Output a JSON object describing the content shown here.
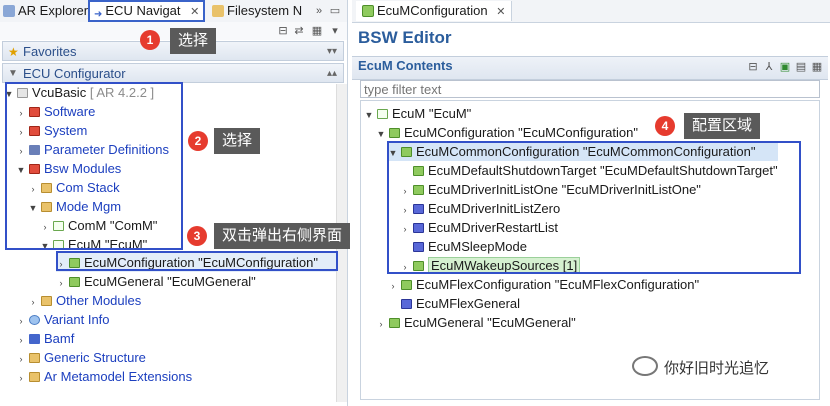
{
  "left_tabs": [
    {
      "label": "AR Explorer"
    },
    {
      "label": "ECU Navigat"
    },
    {
      "label": "Filesystem N"
    }
  ],
  "favorites_label": "Favorites",
  "ecu_configurator_label": "ECU Configurator",
  "tree_left": {
    "vcubasic": "VcuBasic",
    "vcubasic_version": "[ AR 4.2.2 ]",
    "software": "Software",
    "system": "System",
    "parameter_definitions": "Parameter Definitions",
    "bsw_modules": "Bsw Modules",
    "com_stack": "Com Stack",
    "mode_mgm": "Mode Mgm",
    "comm": "ComM \"ComM\"",
    "ecum": "EcuM \"EcuM\"",
    "ecum_configuration": "EcuMConfiguration \"EcuMConfiguration\"",
    "ecum_general": "EcuMGeneral \"EcuMGeneral\"",
    "other_modules": "Other Modules",
    "variant_info": "Variant Info",
    "bamf": "Bamf",
    "generic_structure": "Generic Structure",
    "ar_metamodel_extensions": "Ar Metamodel Extensions"
  },
  "annotations": {
    "a1": {
      "num": "1",
      "text": "选择"
    },
    "a2": {
      "num": "2",
      "text": "选择"
    },
    "a3": {
      "num": "3",
      "text": "双击弹出右侧界面"
    },
    "a4": {
      "num": "4",
      "text": "配置区域"
    }
  },
  "right_tab": {
    "label": "EcuMConfiguration"
  },
  "bsw_editor_title": "BSW Editor",
  "ecum_contents_title": "EcuM Contents",
  "filter": {
    "placeholder": "type filter text"
  },
  "tree_right": {
    "ecum": "EcuM \"EcuM\"",
    "ecum_configuration": "EcuMConfiguration \"EcuMConfiguration\"",
    "ecum_common_configuration": "EcuMCommonConfiguration \"EcuMCommonConfiguration\"",
    "default_shutdown_target": "EcuMDefaultShutdownTarget \"EcuMDefaultShutdownTarget\"",
    "driver_init_list_one": "EcuMDriverInitListOne \"EcuMDriverInitListOne\"",
    "driver_init_list_zero": "EcuMDriverInitListZero",
    "driver_restart_list": "EcuMDriverRestartList",
    "sleep_mode": "EcuMSleepMode",
    "wakeup_sources": "EcuMWakeupSources [1]",
    "flex_configuration": "EcuMFlexConfiguration \"EcuMFlexConfiguration\"",
    "flex_general": "EcuMFlexGeneral",
    "ecum_general": "EcuMGeneral \"EcuMGeneral\""
  },
  "watermark": "你好旧时光追忆",
  "colors": {
    "annotation_box": "#3250c8",
    "badge": "#e63b2e",
    "title_blue": "#2b5d9c"
  }
}
